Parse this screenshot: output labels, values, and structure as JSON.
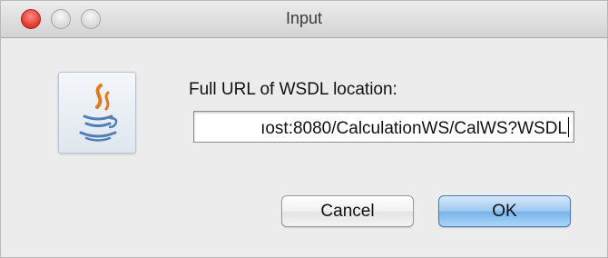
{
  "window": {
    "title": "Input"
  },
  "dialog": {
    "icon": "java-coffee-icon",
    "prompt_label": "Full URL of WSDL location:",
    "input_value": "ıost:8080/CalculationWS/CalWS?WSDL",
    "cancel_label": "Cancel",
    "ok_label": "OK"
  },
  "colors": {
    "close_button": "#e0352b",
    "ok_button": "#78b2ea",
    "background": "#ececec"
  }
}
